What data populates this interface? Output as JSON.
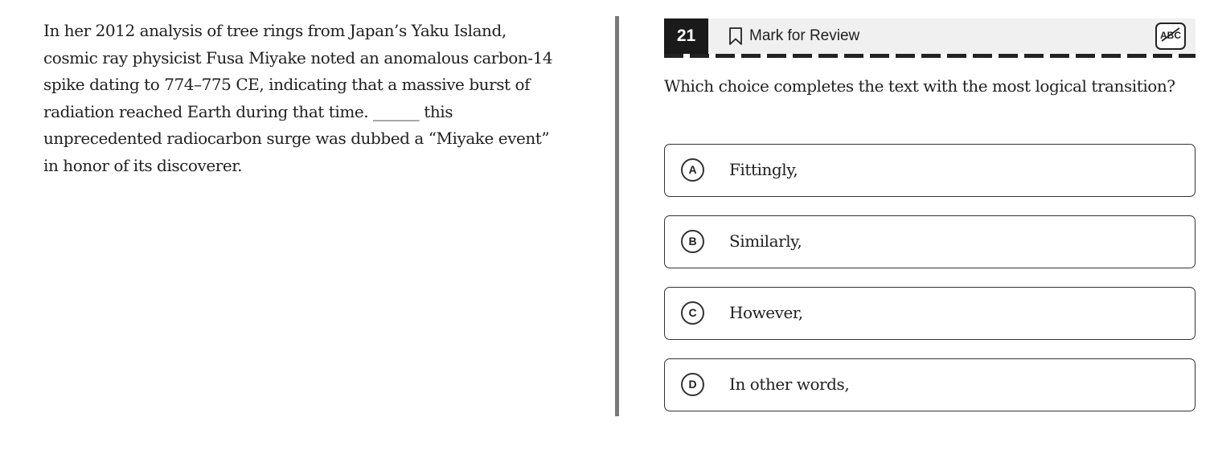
{
  "passage": {
    "text": "In her 2012 analysis of tree rings from Japan’s Yaku Island, cosmic ray physicist Fusa Miyake noted an anomalous carbon-14 spike dating to 774–775 CE, indicating that a massive burst of radiation reached Earth during that time. ______ this unprecedented radiocarbon surge was dubbed a “Miyake event” in honor of its discoverer."
  },
  "question": {
    "number": "21",
    "mark_for_review_label": "Mark for Review",
    "abc_icon": "abc-strikethrough-icon",
    "prompt": "Which choice completes the text with the most logical transition?",
    "choices": [
      {
        "letter": "A",
        "text": "Fittingly,"
      },
      {
        "letter": "B",
        "text": "Similarly,"
      },
      {
        "letter": "C",
        "text": "However,"
      },
      {
        "letter": "D",
        "text": "In other words,"
      }
    ]
  },
  "colors": {
    "header_background": "#f0f0f0",
    "number_badge": "#1a1a1a",
    "divider": "#7a7a7a",
    "border": "#333333"
  }
}
